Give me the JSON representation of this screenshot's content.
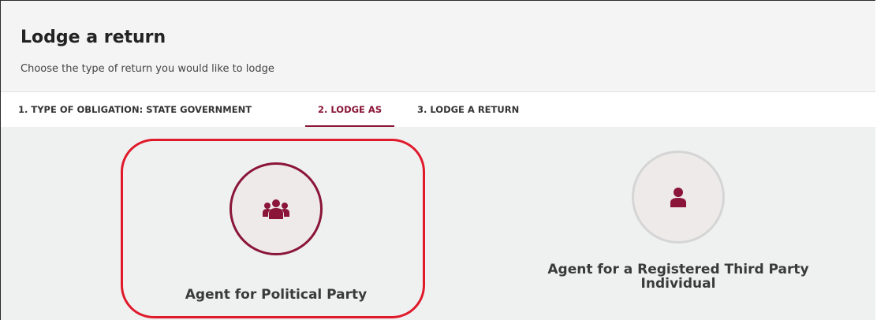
{
  "header": {
    "title": "Lodge a return",
    "subtitle": "Choose the type of return you would like to lodge"
  },
  "tabs": [
    {
      "label": "1. TYPE OF OBLIGATION: STATE GOVERNMENT",
      "active": false
    },
    {
      "label": "2. LODGE AS",
      "active": true
    },
    {
      "label": "3. LODGE A RETURN",
      "active": false
    }
  ],
  "options": [
    {
      "label": "Agent for Political Party",
      "icon": "users-icon",
      "selected": true
    },
    {
      "label_line1": "Agent for a Registered Third Party",
      "label_line2": "Individual",
      "icon": "user-icon",
      "selected": false
    }
  ],
  "colors": {
    "accent": "#8a1538",
    "highlight": "#e01a2b",
    "content_bg": "#eff1f1",
    "header_bg": "#f4f4f4"
  }
}
